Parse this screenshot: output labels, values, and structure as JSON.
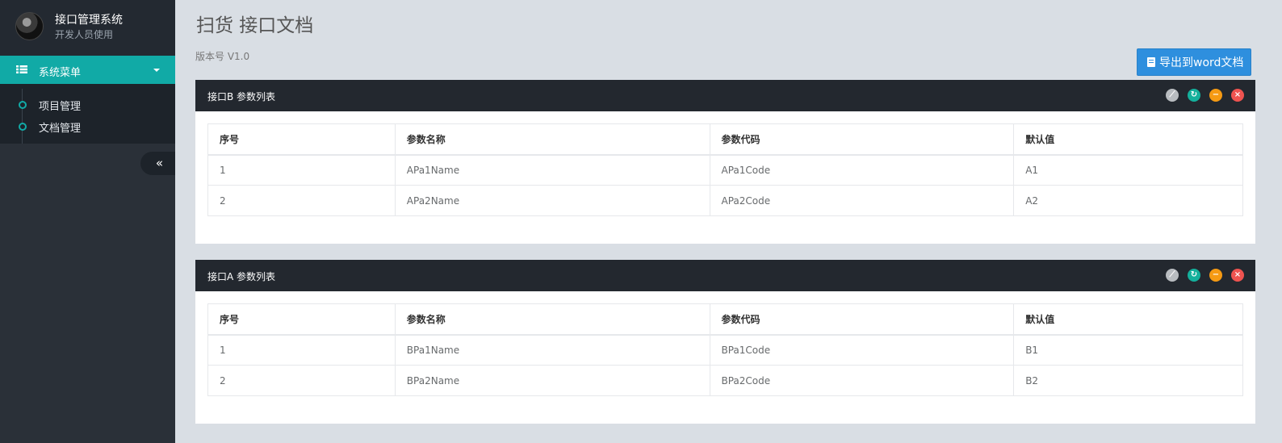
{
  "sidebar": {
    "brand_title": "接口管理系统",
    "brand_subtitle": "开发人员使用",
    "menu_label": "系统菜单",
    "items": [
      {
        "label": "项目管理"
      },
      {
        "label": "文档管理"
      }
    ],
    "collapse_glyph": "«"
  },
  "main": {
    "title": "扫货 接口文档",
    "version": "版本号 V1.0",
    "export_label": "导出到word文档"
  },
  "panels": [
    {
      "title": "接口B 参数列表",
      "headers": [
        "序号",
        "参数名称",
        "参数代码",
        "默认值"
      ],
      "rows": [
        [
          "1",
          "APa1Name",
          "APa1Code",
          "A1"
        ],
        [
          "2",
          "APa2Name",
          "APa2Code",
          "A2"
        ]
      ]
    },
    {
      "title": "接口A 参数列表",
      "headers": [
        "序号",
        "参数名称",
        "参数代码",
        "默认值"
      ],
      "rows": [
        [
          "1",
          "BPa1Name",
          "BPa1Code",
          "B1"
        ],
        [
          "2",
          "BPa2Name",
          "BPa2Code",
          "B2"
        ]
      ]
    }
  ],
  "colors": {
    "sidebar_bg": "#2a3038",
    "accent_teal": "#11aaa6",
    "export_blue": "#2e8fde",
    "panel_header": "#23282f"
  },
  "tool_icons": [
    "wrench-icon",
    "refresh-icon",
    "minimize-icon",
    "close-icon"
  ]
}
